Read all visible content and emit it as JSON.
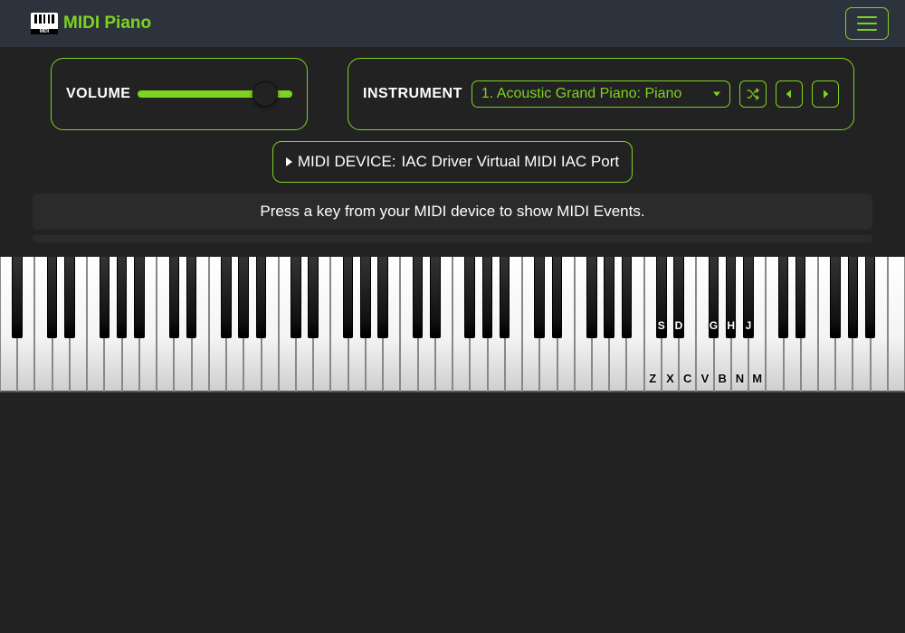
{
  "header": {
    "brand": "MIDI Piano"
  },
  "controls": {
    "volume_label": "VOLUME",
    "volume_value": 90,
    "instrument_label": "INSTRUMENT",
    "instrument_selected": "1. Acoustic Grand Piano: Piano"
  },
  "midi": {
    "device_label": "MIDI DEVICE:",
    "device_name": "IAC Driver Virtual MIDI IAC Port"
  },
  "hint": "Press a key from your MIDI device to show MIDI Events.",
  "keyboard": {
    "white_key_count": 52,
    "white_labels": {
      "37": "Z",
      "38": "X",
      "39": "C",
      "40": "V",
      "41": "B",
      "42": "N",
      "43": "M"
    },
    "black_labels": {
      "S": 37,
      "D": 38,
      "G": 40,
      "H": 41,
      "J": 42
    },
    "black_pattern_pc": [
      1,
      3,
      6,
      8,
      10
    ]
  }
}
